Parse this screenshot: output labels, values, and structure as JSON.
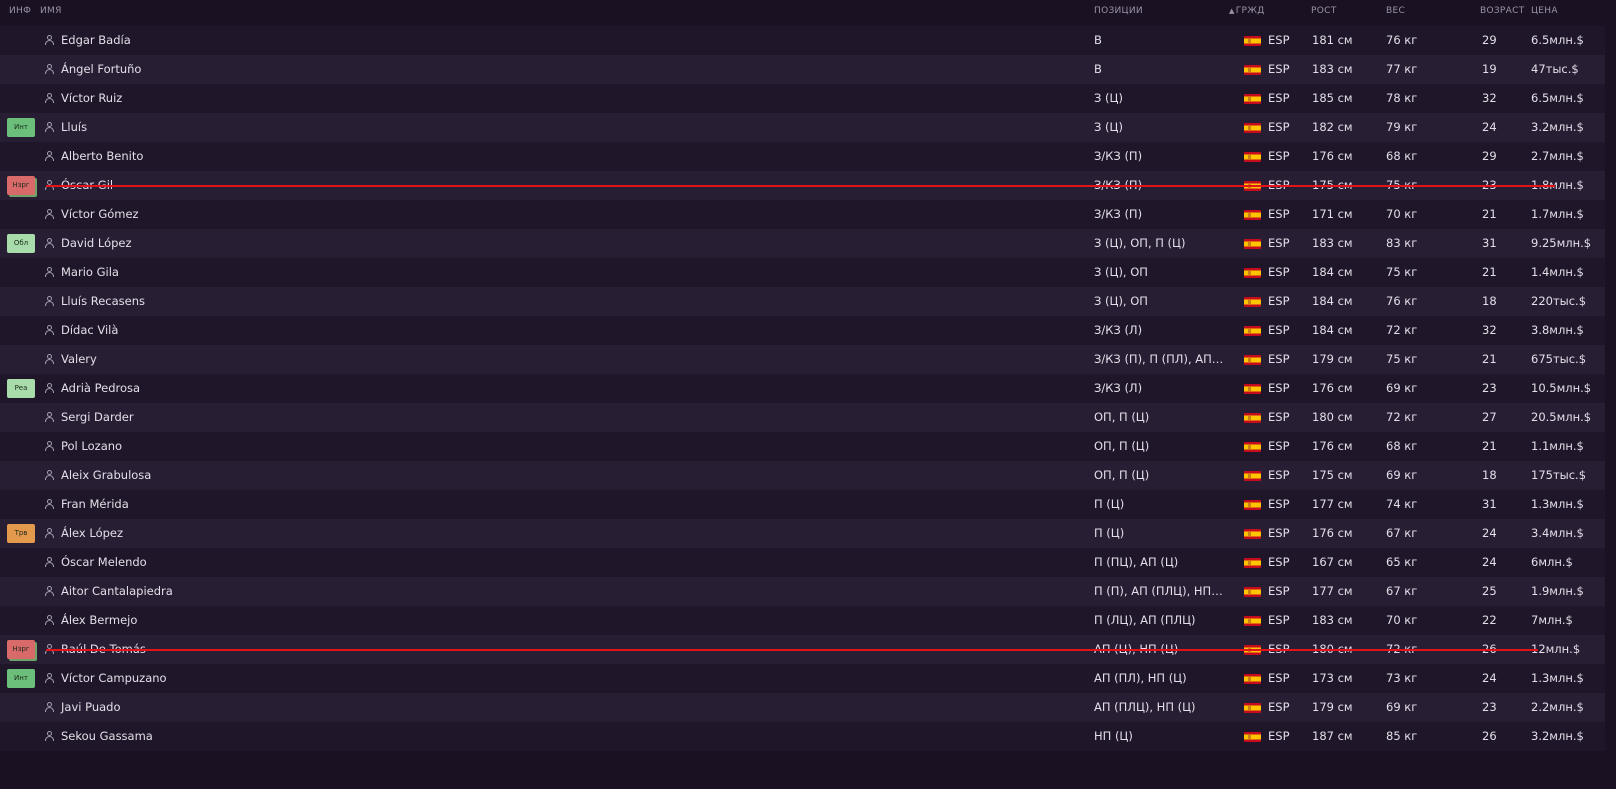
{
  "columns": {
    "info": "ИНФ",
    "name": "ИМЯ",
    "positions": "ПОЗИЦИИ",
    "nationality": "ГРЖД",
    "height": "РОСТ",
    "weight": "ВЕС",
    "age": "ВОЗРАСТ",
    "value": "ЦЕНА"
  },
  "sort": {
    "column": "nationality",
    "direction": "ascending"
  },
  "badge_colors": {
    "Инт": "#6cbf7a",
    "Нзрг": "#d96a6a",
    "Обл": "#a8dcaa",
    "Реа": "#a8dcaa",
    "Трв": "#e49a4c"
  },
  "players": [
    {
      "badge": "",
      "name": "Edgar Badía",
      "positions": "В",
      "nat": "ESP",
      "height": "181 см",
      "weight": "76 кг",
      "age": "29",
      "value": "6.5млн.$",
      "struck": false
    },
    {
      "badge": "",
      "name": "Ángel Fortuño",
      "positions": "В",
      "nat": "ESP",
      "height": "183 см",
      "weight": "77 кг",
      "age": "19",
      "value": "47тыс.$",
      "struck": false
    },
    {
      "badge": "",
      "name": "Víctor Ruiz",
      "positions": "З (Ц)",
      "nat": "ESP",
      "height": "185 см",
      "weight": "78 кг",
      "age": "32",
      "value": "6.5млн.$",
      "struck": false
    },
    {
      "badge": "Инт",
      "name": "Lluís",
      "positions": "З (Ц)",
      "nat": "ESP",
      "height": "182 см",
      "weight": "79 кг",
      "age": "24",
      "value": "3.2млн.$",
      "struck": false
    },
    {
      "badge": "",
      "name": "Alberto Benito",
      "positions": "З/КЗ (П)",
      "nat": "ESP",
      "height": "176 см",
      "weight": "68 кг",
      "age": "29",
      "value": "2.7млн.$",
      "struck": false
    },
    {
      "badge": "Нзрг",
      "name": "Óscar Gil",
      "positions": "З/КЗ (П)",
      "nat": "ESP",
      "height": "175 см",
      "weight": "75 кг",
      "age": "23",
      "value": "1.8млн.$",
      "struck": true
    },
    {
      "badge": "",
      "name": "Víctor Gómez",
      "positions": "З/КЗ (П)",
      "nat": "ESP",
      "height": "171 см",
      "weight": "70 кг",
      "age": "21",
      "value": "1.7млн.$",
      "struck": false
    },
    {
      "badge": "Обл",
      "name": "David López",
      "positions": "З (Ц), ОП, П (Ц)",
      "nat": "ESP",
      "height": "183 см",
      "weight": "83 кг",
      "age": "31",
      "value": "9.25млн.$",
      "struck": false
    },
    {
      "badge": "",
      "name": "Mario Gila",
      "positions": "З (Ц), ОП",
      "nat": "ESP",
      "height": "184 см",
      "weight": "75 кг",
      "age": "21",
      "value": "1.4млн.$",
      "struck": false
    },
    {
      "badge": "",
      "name": "Lluís Recasens",
      "positions": "З (Ц), ОП",
      "nat": "ESP",
      "height": "184 см",
      "weight": "76 кг",
      "age": "18",
      "value": "220тыс.$",
      "struck": false
    },
    {
      "badge": "",
      "name": "Dídac Vilà",
      "positions": "З/КЗ (Л)",
      "nat": "ESP",
      "height": "184 см",
      "weight": "72 кг",
      "age": "32",
      "value": "3.8млн.$",
      "struck": false
    },
    {
      "badge": "",
      "name": "Valery",
      "positions": "З/КЗ (П), П (ПЛ), АП (П...",
      "nat": "ESP",
      "height": "179 см",
      "weight": "75 кг",
      "age": "21",
      "value": "675тыс.$",
      "struck": false
    },
    {
      "badge": "Реа",
      "name": "Adrià Pedrosa",
      "positions": "З/КЗ (Л)",
      "nat": "ESP",
      "height": "176 см",
      "weight": "69 кг",
      "age": "23",
      "value": "10.5млн.$",
      "struck": false
    },
    {
      "badge": "",
      "name": "Sergi Darder",
      "positions": "ОП, П (Ц)",
      "nat": "ESP",
      "height": "180 см",
      "weight": "72 кг",
      "age": "27",
      "value": "20.5млн.$",
      "struck": false
    },
    {
      "badge": "",
      "name": "Pol Lozano",
      "positions": "ОП, П (Ц)",
      "nat": "ESP",
      "height": "176 см",
      "weight": "68 кг",
      "age": "21",
      "value": "1.1млн.$",
      "struck": false
    },
    {
      "badge": "",
      "name": "Aleix Grabulosa",
      "positions": "ОП, П (Ц)",
      "nat": "ESP",
      "height": "175 см",
      "weight": "69 кг",
      "age": "18",
      "value": "175тыс.$",
      "struck": false
    },
    {
      "badge": "",
      "name": "Fran Mérida",
      "positions": "П (Ц)",
      "nat": "ESP",
      "height": "177 см",
      "weight": "74 кг",
      "age": "31",
      "value": "1.3млн.$",
      "struck": false
    },
    {
      "badge": "Трв",
      "name": "Álex López",
      "positions": "П (Ц)",
      "nat": "ESP",
      "height": "176 см",
      "weight": "67 кг",
      "age": "24",
      "value": "3.4млн.$",
      "struck": false
    },
    {
      "badge": "",
      "name": "Óscar Melendo",
      "positions": "П (ПЦ), АП (Ц)",
      "nat": "ESP",
      "height": "167 см",
      "weight": "65 кг",
      "age": "24",
      "value": "6млн.$",
      "struck": false
    },
    {
      "badge": "",
      "name": "Aitor Cantalapiedra",
      "positions": "П (П), АП (ПЛЦ), НП (Ц)",
      "nat": "ESP",
      "height": "177 см",
      "weight": "67 кг",
      "age": "25",
      "value": "1.9млн.$",
      "struck": false
    },
    {
      "badge": "",
      "name": "Álex Bermejo",
      "positions": "П (ЛЦ), АП (ПЛЦ)",
      "nat": "ESP",
      "height": "183 см",
      "weight": "70 кг",
      "age": "22",
      "value": "7млн.$",
      "struck": false
    },
    {
      "badge": "Нзрг",
      "name": "Raúl De Tomás",
      "positions": "АП (Ц), НП (Ц)",
      "nat": "ESP",
      "height": "180 см",
      "weight": "72 кг",
      "age": "26",
      "value": "12млн.$",
      "struck": true
    },
    {
      "badge": "Инт",
      "name": "Víctor Campuzano",
      "positions": "АП (ПЛ), НП (Ц)",
      "nat": "ESP",
      "height": "173 см",
      "weight": "73 кг",
      "age": "24",
      "value": "1.3млн.$",
      "struck": false
    },
    {
      "badge": "",
      "name": "Javi Puado",
      "positions": "АП (ПЛЦ), НП (Ц)",
      "nat": "ESP",
      "height": "179 см",
      "weight": "69 кг",
      "age": "23",
      "value": "2.2млн.$",
      "struck": false
    },
    {
      "badge": "",
      "name": "Sekou Gassama",
      "positions": "НП (Ц)",
      "nat": "ESP",
      "height": "187 см",
      "weight": "85 кг",
      "age": "26",
      "value": "3.2млн.$",
      "struck": false
    }
  ]
}
